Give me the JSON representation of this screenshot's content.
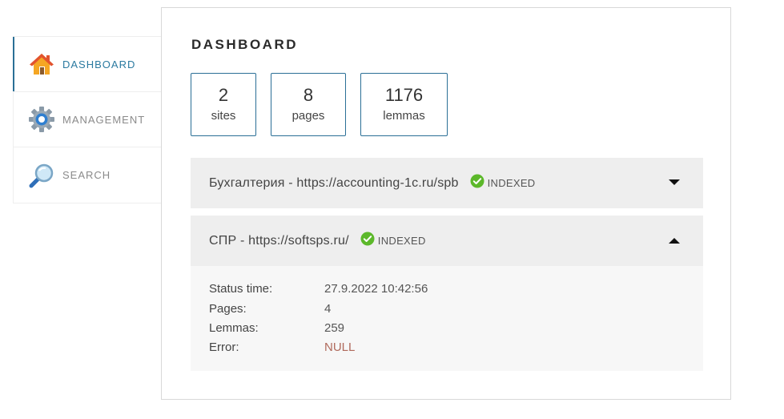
{
  "sidebar": {
    "items": [
      {
        "label": "DASHBOARD",
        "icon": "home-icon",
        "active": true
      },
      {
        "label": "MANAGEMENT",
        "icon": "gear-icon",
        "active": false
      },
      {
        "label": "SEARCH",
        "icon": "magnifier-icon",
        "active": false
      }
    ]
  },
  "main": {
    "title": "DASHBOARD",
    "stats": [
      {
        "value": "2",
        "label": "sites"
      },
      {
        "value": "8",
        "label": "pages"
      },
      {
        "value": "1176",
        "label": "lemmas"
      }
    ],
    "sites": [
      {
        "name": "Бухгалтерия - https://accounting-1c.ru/spb",
        "status": "INDEXED",
        "expanded": false
      },
      {
        "name": "СПР - https://softsps.ru/",
        "status": "INDEXED",
        "expanded": true
      }
    ],
    "details": {
      "status_time_label": "Status time:",
      "status_time": "27.9.2022 10:42:56",
      "pages_label": "Pages:",
      "pages": "4",
      "lemmas_label": "Lemmas:",
      "lemmas": "259",
      "error_label": "Error:",
      "error": "NULL"
    }
  },
  "colors": {
    "accent": "#2b6f96",
    "indexed": "#5cb82a",
    "error": "#b06a5c"
  }
}
